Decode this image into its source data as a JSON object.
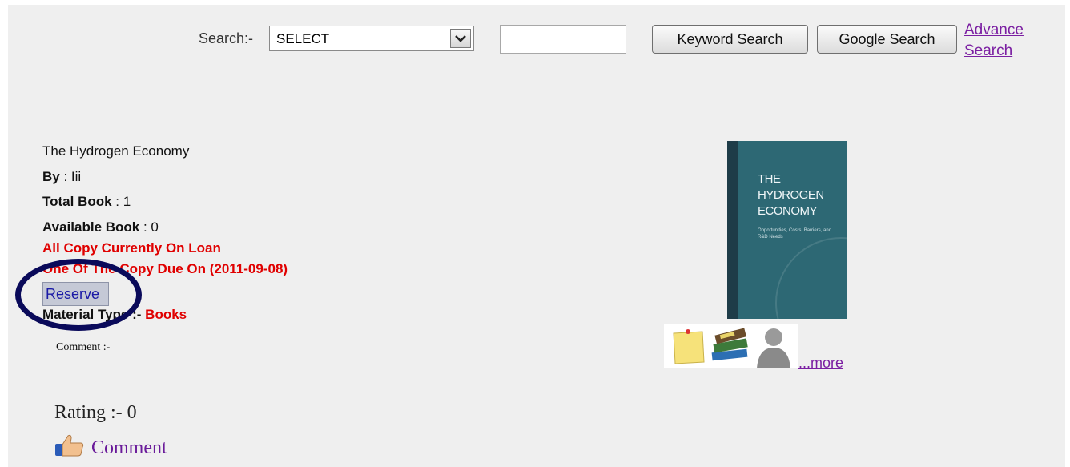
{
  "search": {
    "label": "Search:-",
    "select_value": "SELECT",
    "input_value": "",
    "keyword_button": "Keyword Search",
    "google_button": "Google Search",
    "advance_link": "Advance Search"
  },
  "book": {
    "title": "The Hydrogen Economy",
    "by_label": "By",
    "by_value": " : Iii",
    "total_label": "Total Book",
    "total_value": " : 1",
    "available_label": "Available Book",
    "available_value": " : 0",
    "loan_status": "All Copy Currently On Loan",
    "due_text": "One Of The Copy Due On (2011-09-08)",
    "reserve_button": "Reserve",
    "material_label": "Material Type :-",
    "material_value": "Books",
    "comment_label": "Comment :-",
    "rating_text": "Rating :- 0",
    "comment_link": "Comment"
  },
  "cover": {
    "title_line1": "THE",
    "title_line2": "HYDROGEN",
    "title_line3": "ECONOMY",
    "subtitle": "Opportunities, Costs, Barriers, and R&D Needs"
  },
  "actions": {
    "icons": [
      "sticky-note-icon",
      "books-icon",
      "user-icon"
    ],
    "more_link": "...more"
  },
  "colors": {
    "status_red": "#e00000",
    "link_purple": "#7b1fa2",
    "highlight_ring": "#0a0a5a",
    "background": "#efefef"
  }
}
